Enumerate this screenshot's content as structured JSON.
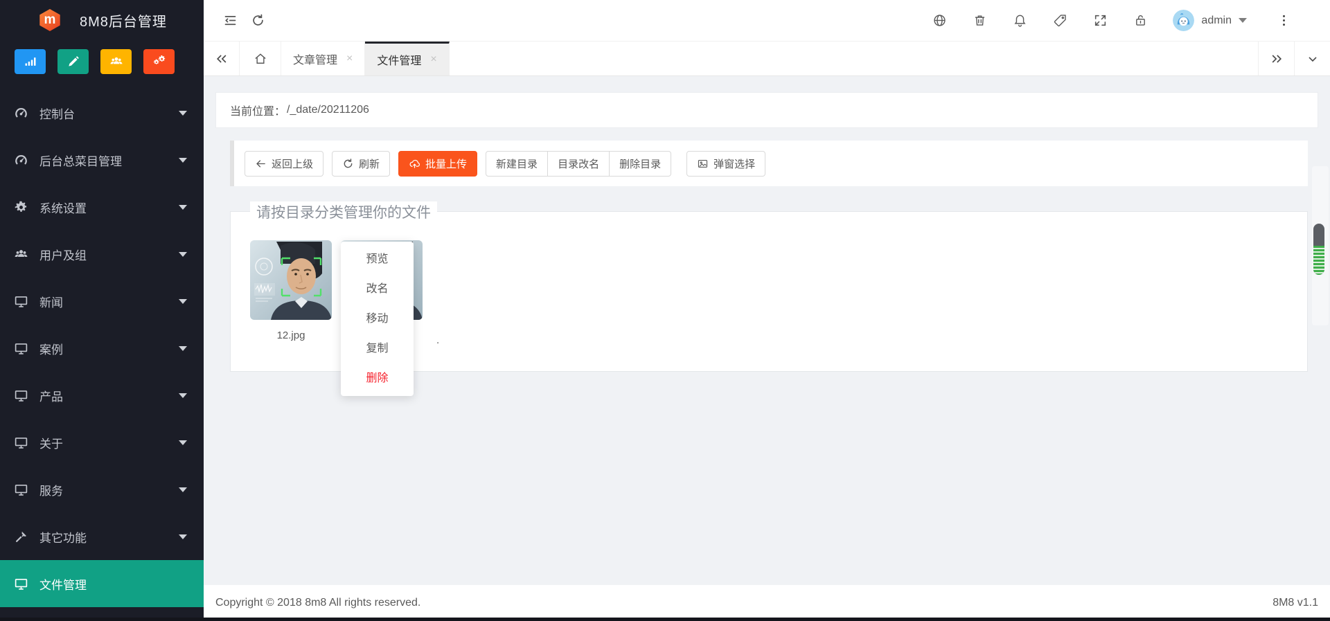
{
  "app": {
    "title": "8M8后台管理"
  },
  "colors": {
    "sidebar_bg": "#1b1d27",
    "accent_teal": "#11a185",
    "accent_orange": "#fa541c",
    "danger_red": "#f5222d",
    "content_bg": "#f0f2f5",
    "tab_active_border": "#23252b"
  },
  "sidebar": {
    "shortcuts": [
      {
        "icon": "bar-chart-icon",
        "color": "#2196f3"
      },
      {
        "icon": "pencil-icon",
        "color": "#11a185"
      },
      {
        "icon": "user-group-icon",
        "color": "#ffb400"
      },
      {
        "icon": "gears-icon",
        "color": "#fa4b1e"
      }
    ],
    "items": [
      {
        "label": "控制台",
        "icon": "gauge-icon"
      },
      {
        "label": "后台总菜目管理",
        "icon": "gauge-icon"
      },
      {
        "label": "系统设置",
        "icon": "gear-icon"
      },
      {
        "label": "用户及组",
        "icon": "users-icon"
      },
      {
        "label": "新闻",
        "icon": "monitor-icon"
      },
      {
        "label": "案例",
        "icon": "monitor-icon"
      },
      {
        "label": "产品",
        "icon": "monitor-icon"
      },
      {
        "label": "关于",
        "icon": "monitor-icon"
      },
      {
        "label": "服务",
        "icon": "monitor-icon"
      },
      {
        "label": "其它功能",
        "icon": "hammer-icon"
      },
      {
        "label": "文件管理",
        "icon": "monitor-icon",
        "active": true
      }
    ]
  },
  "header": {
    "user": "admin",
    "icons": [
      "menu-fold-icon",
      "refresh-icon",
      "globe-icon",
      "trash-icon",
      "bell-icon",
      "tag-icon",
      "fullscreen-icon",
      "lock-icon",
      "more-icon"
    ]
  },
  "tabs": [
    {
      "label": "文章管理",
      "active": false
    },
    {
      "label": "文件管理",
      "active": true
    }
  ],
  "breadcrumb": {
    "label": "当前位置：",
    "path": "/_date/20211206"
  },
  "toolbar": {
    "back": "返回上级",
    "refresh": "刷新",
    "upload": "批量上传",
    "new_dir": "新建目录",
    "rename_dir": "目录改名",
    "delete_dir": "删除目录",
    "popup_select": "弹窗选择"
  },
  "file_panel": {
    "legend": "请按目录分类管理你的文件",
    "files": [
      {
        "name": "12.jpg"
      },
      {
        "name_partial": "."
      }
    ]
  },
  "context_menu": {
    "items": [
      {
        "label": "预览"
      },
      {
        "label": "改名"
      },
      {
        "label": "移动"
      },
      {
        "label": "复制"
      },
      {
        "label": "删除",
        "danger": true
      }
    ]
  },
  "footer": {
    "copyright": "Copyright © 2018 8m8 All rights reserved.",
    "version": "8M8 v1.1"
  }
}
